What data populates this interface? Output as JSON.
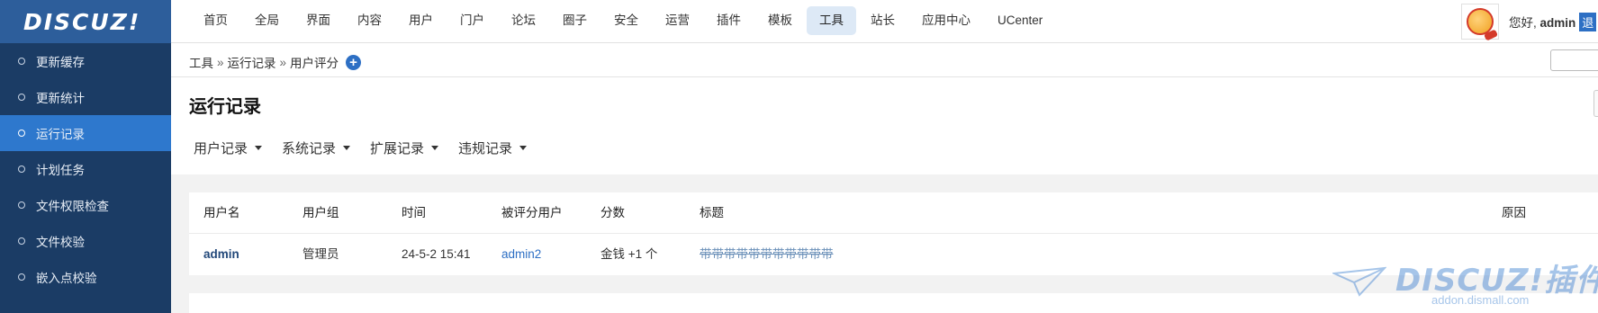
{
  "logo": {
    "text": "DISCUZ!"
  },
  "nav": {
    "items": [
      "首页",
      "全局",
      "界面",
      "内容",
      "用户",
      "门户",
      "论坛",
      "圈子",
      "安全",
      "运营",
      "插件",
      "模板",
      "工具",
      "站长",
      "应用中心",
      "UCenter"
    ],
    "active_index": 12
  },
  "user": {
    "greeting": "您好, ",
    "name": "admin",
    "logout": "退"
  },
  "sidebar": {
    "items": [
      "更新缓存",
      "更新统计",
      "运行记录",
      "计划任务",
      "文件权限检查",
      "文件校验",
      "嵌入点校验"
    ],
    "active_index": 2
  },
  "breadcrumb": {
    "items": [
      "工具",
      "运行记录",
      "用户评分"
    ],
    "separator": "»",
    "add_icon": "plus-circle-icon"
  },
  "page": {
    "title": "运行记录",
    "tabs": [
      "用户记录",
      "系统记录",
      "扩展记录",
      "违规记录"
    ]
  },
  "table": {
    "headers": [
      "用户名",
      "用户组",
      "时间",
      "被评分用户",
      "分数",
      "标题",
      "原因"
    ],
    "rows": [
      {
        "username": "admin",
        "group": "管理员",
        "time": "24-5-2 15:41",
        "rated_user": "admin2",
        "score": "金钱 +1 个",
        "title": "带带带带带带带带带带带",
        "reason": ""
      }
    ]
  },
  "watermark": {
    "brand": "DISCUZ!插件网",
    "url": "addon.dismall.com"
  },
  "colors": {
    "brand": "#2d5e9b",
    "sidebar": "#1b3c65",
    "sidebar_active": "#2e78cd",
    "link": "#2d6fc4"
  }
}
